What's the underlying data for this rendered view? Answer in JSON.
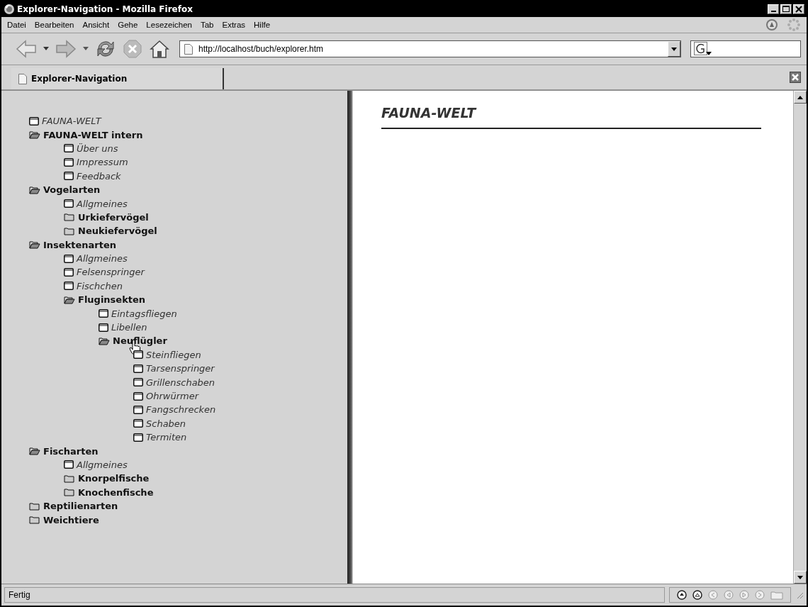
{
  "window": {
    "title": "Explorer-Navigation - Mozilla Firefox"
  },
  "menu": [
    "Datei",
    "Bearbeiten",
    "Ansicht",
    "Gehe",
    "Lesezeichen",
    "Tab",
    "Extras",
    "Hilfe"
  ],
  "address_bar": {
    "value": "http://localhost/buch/explorer.htm"
  },
  "tabs": [
    {
      "label": "Explorer-Navigation",
      "selected": true
    }
  ],
  "tree": [
    {
      "label": "FAUNA-WELT",
      "kind": "page"
    },
    {
      "label": "FAUNA-WELT intern",
      "kind": "folder",
      "expanded": true,
      "children": [
        {
          "label": "Über uns",
          "kind": "page"
        },
        {
          "label": "Impressum",
          "kind": "page"
        },
        {
          "label": "Feedback",
          "kind": "page"
        }
      ]
    },
    {
      "label": "Vogelarten",
      "kind": "folder",
      "expanded": true,
      "children": [
        {
          "label": "Allgmeines",
          "kind": "page"
        },
        {
          "label": "Urkiefervögel",
          "kind": "folder",
          "expanded": false
        },
        {
          "label": "Neukiefervögel",
          "kind": "folder",
          "expanded": false
        }
      ]
    },
    {
      "label": "Insektenarten",
      "kind": "folder",
      "expanded": true,
      "children": [
        {
          "label": "Allgmeines",
          "kind": "page"
        },
        {
          "label": "Felsenspringer",
          "kind": "page"
        },
        {
          "label": "Fischchen",
          "kind": "page"
        },
        {
          "label": "Fluginsekten",
          "kind": "folder",
          "expanded": true,
          "children": [
            {
              "label": "Eintagsfliegen",
              "kind": "page"
            },
            {
              "label": "Libellen",
              "kind": "page"
            },
            {
              "label": "Neuflügler",
              "kind": "folder",
              "expanded": true,
              "children": [
                {
                  "label": "Steinfliegen",
                  "kind": "page"
                },
                {
                  "label": "Tarsenspringer",
                  "kind": "page"
                },
                {
                  "label": "Grillenschaben",
                  "kind": "page"
                },
                {
                  "label": "Ohrwürmer",
                  "kind": "page"
                },
                {
                  "label": "Fangschrecken",
                  "kind": "page"
                },
                {
                  "label": "Schaben",
                  "kind": "page"
                },
                {
                  "label": "Termiten",
                  "kind": "page"
                }
              ]
            }
          ]
        }
      ]
    },
    {
      "label": "Fischarten",
      "kind": "folder",
      "expanded": true,
      "children": [
        {
          "label": "Allgmeines",
          "kind": "page"
        },
        {
          "label": "Knorpelfische",
          "kind": "folder",
          "expanded": false
        },
        {
          "label": "Knochenfische",
          "kind": "folder",
          "expanded": false
        }
      ]
    },
    {
      "label": "Reptilienarten",
      "kind": "folder",
      "expanded": false
    },
    {
      "label": "Weichtiere",
      "kind": "folder",
      "expanded": false
    }
  ],
  "content": {
    "heading": "FAUNA-WELT"
  },
  "status_bar": {
    "text": "Fertig"
  }
}
